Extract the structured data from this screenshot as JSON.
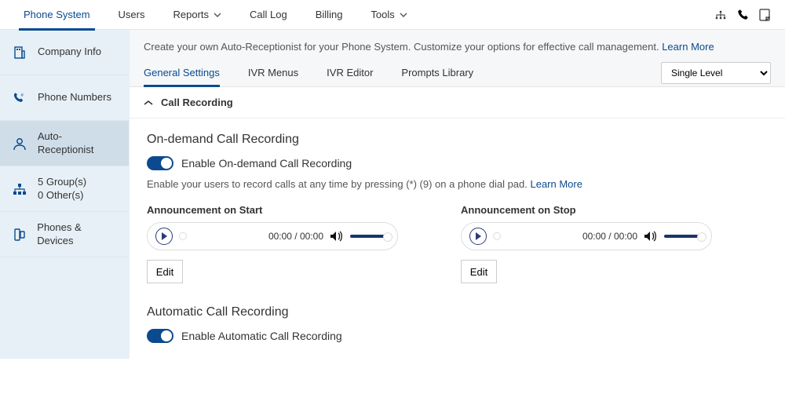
{
  "topnav": {
    "items": [
      {
        "label": "Phone System",
        "active": true,
        "chevron": false
      },
      {
        "label": "Users",
        "active": false,
        "chevron": false
      },
      {
        "label": "Reports",
        "active": false,
        "chevron": true
      },
      {
        "label": "Call Log",
        "active": false,
        "chevron": false
      },
      {
        "label": "Billing",
        "active": false,
        "chevron": false
      },
      {
        "label": "Tools",
        "active": false,
        "chevron": true
      }
    ]
  },
  "sidebar": {
    "items": [
      {
        "label": "Company Info",
        "icon": "company",
        "selected": false
      },
      {
        "label": "Phone Numbers",
        "icon": "phone",
        "selected": false
      },
      {
        "label": "Auto-Receptionist",
        "icon": "person",
        "selected": true
      },
      {
        "label": "5 Group(s)",
        "sublabel": "0 Other(s)",
        "icon": "group",
        "selected": false
      },
      {
        "label": "Phones & Devices",
        "icon": "device",
        "selected": false
      }
    ]
  },
  "intro": {
    "text": "Create your own Auto-Receptionist for your Phone System. Customize your options for effective call management. ",
    "learn_more": "Learn More"
  },
  "subtabs": {
    "items": [
      {
        "label": "General Settings",
        "active": true
      },
      {
        "label": "IVR Menus",
        "active": false
      },
      {
        "label": "IVR Editor",
        "active": false
      },
      {
        "label": "Prompts Library",
        "active": false
      }
    ],
    "level_select": "Single Level"
  },
  "section": {
    "title": "Call Recording"
  },
  "ondemand": {
    "title": "On-demand Call Recording",
    "toggle_label": "Enable On-demand Call Recording",
    "toggle_on": true,
    "desc_prefix": "Enable your users to record calls at any time by pressing (*) (9) on a phone dial pad. ",
    "learn_more": "Learn More",
    "start": {
      "title": "Announcement on Start",
      "time": "00:00 / 00:00",
      "edit": "Edit"
    },
    "stop": {
      "title": "Announcement on Stop",
      "time": "00:00 / 00:00",
      "edit": "Edit"
    }
  },
  "automatic": {
    "title": "Automatic Call Recording",
    "toggle_label": "Enable Automatic Call Recording",
    "toggle_on": true
  }
}
